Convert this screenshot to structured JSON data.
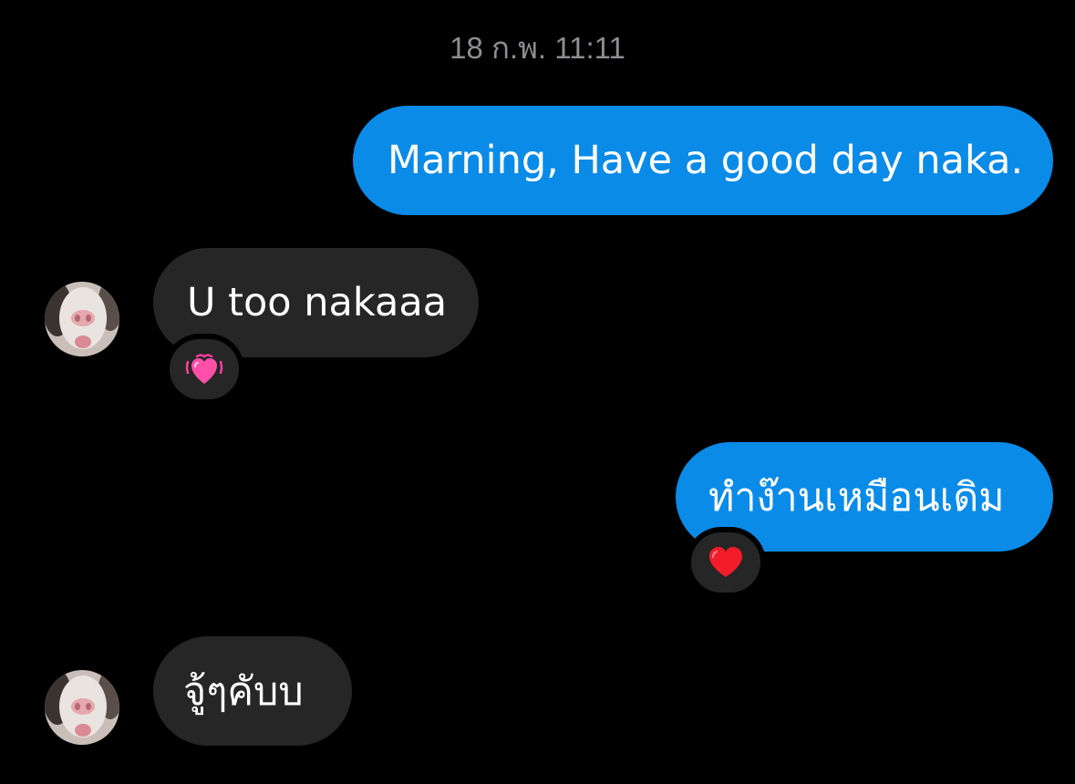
{
  "conversation": {
    "timestamp": "18 ก.พ. 11:11",
    "messages": [
      {
        "direction": "outgoing",
        "text": "Marning, Have a good day naka."
      },
      {
        "direction": "incoming",
        "text": "U too nakaaa",
        "reaction": "growing-heart-icon"
      },
      {
        "direction": "outgoing",
        "text": "ทำง๊านเหมือนเดิม",
        "reaction": "red-heart-icon"
      },
      {
        "direction": "incoming",
        "text": "จู้ๆคับบ"
      }
    ]
  },
  "colors": {
    "background": "#000000",
    "outgoing_bubble": "#0a8be8",
    "incoming_bubble": "#262626",
    "timestamp_text": "#8e8e93"
  }
}
